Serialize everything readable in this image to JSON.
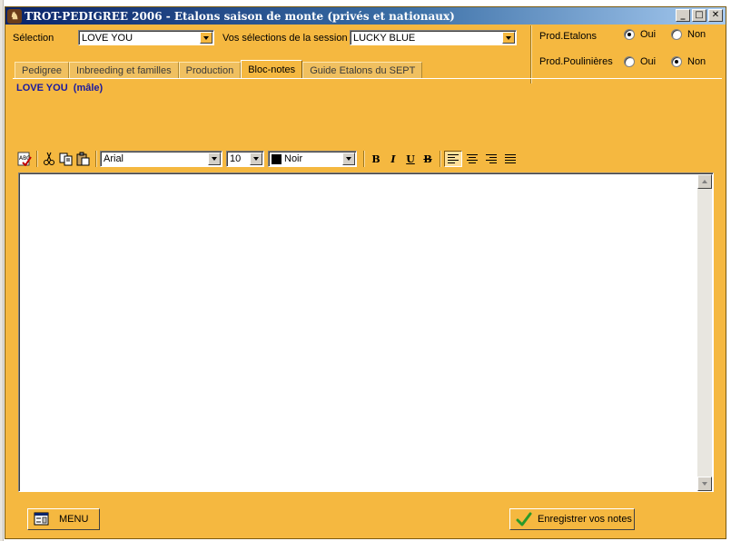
{
  "window": {
    "app_name": "TROT-PEDIGREE 2006",
    "title_sep": " - ",
    "subtitle": "Etalons saison de monte (privés et nationaux)",
    "min_glyph": "_",
    "max_glyph": "□",
    "close_glyph": "✕"
  },
  "header": {
    "selection_label": "Sélection",
    "selection_value": "LOVE YOU",
    "session_label": "Vos sélections de la session",
    "session_value": "LUCKY BLUE"
  },
  "filters": {
    "prod_etalons_label": "Prod.Etalons",
    "prod_poulinieres_label": "Prod.Poulinières",
    "oui": "Oui",
    "non": "Non",
    "prod_etalons_selected": "Oui",
    "prod_poulinieres_selected": "Non"
  },
  "tabs": [
    {
      "label": "Pedigree"
    },
    {
      "label": "Inbreeding et familles"
    },
    {
      "label": "Production"
    },
    {
      "label": "Bloc-notes"
    },
    {
      "label": "Guide Etalons du SEPT"
    }
  ],
  "active_tab": "Bloc-notes",
  "horse": {
    "name": "LOVE YOU",
    "sex": "(mâle)"
  },
  "editor_toolbar": {
    "font": "Arial",
    "size": "10",
    "color_name": "Noir",
    "color_hex": "#000000",
    "bold": "B",
    "italic": "I",
    "underline": "U",
    "strike": "B"
  },
  "notes_text": "",
  "buttons": {
    "menu": "MENU",
    "save": "Enregistrer vos notes"
  },
  "colors": {
    "window_bg": "#f5b840",
    "title_start": "#0a246a",
    "title_end": "#a6caf0",
    "horse_name": "#1a1aa0"
  }
}
